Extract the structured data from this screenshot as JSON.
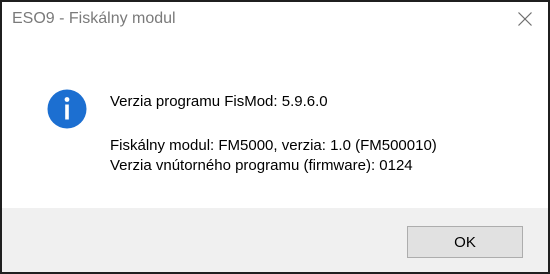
{
  "window": {
    "title": "ESO9 - Fiskálny modul",
    "close_icon": "close-icon"
  },
  "message": {
    "icon": "info-icon",
    "line1": "Verzia programu FisMod: 5.9.6.0",
    "line2": "Fiskálny modul: FM5000, verzia: 1.0  (FM500010)",
    "line3": "Verzia vnútorného programu (firmware): 0124"
  },
  "buttons": {
    "ok_label": "OK"
  },
  "colors": {
    "info_icon": "#1c6fd1",
    "footer_bg": "#f0f0f0",
    "title_text": "#7a7a7a"
  }
}
